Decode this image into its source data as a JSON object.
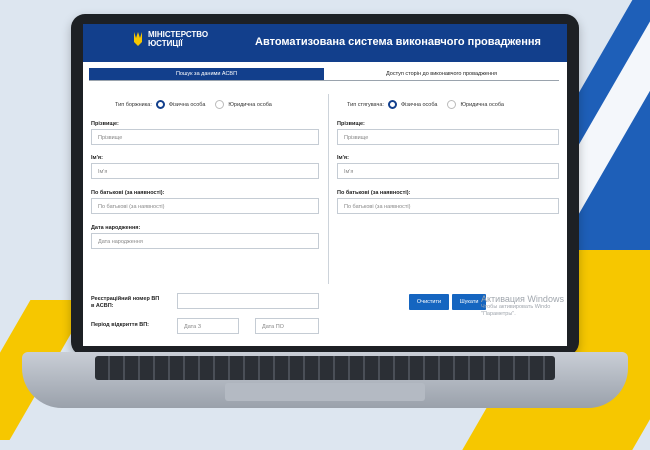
{
  "header": {
    "logo_line1": "МІНІСТЕРСТВО",
    "logo_line2": "ЮСТИЦІЇ",
    "title": "Автоматизована система виконавчого провадження"
  },
  "tabs": [
    {
      "label": "Пошук за даними АСВП"
    },
    {
      "label": "Доступ сторін до виконавчого провадження"
    }
  ],
  "left": {
    "type_label": "Тип боржника:",
    "option1": "Фізична особа",
    "option2": "Юридична особа",
    "surname_label": "Прізвище:",
    "surname_placeholder": "Прізвище",
    "name_label": "Ім'я:",
    "name_placeholder": "Ім'я",
    "patronymic_label": "По батькові (за наявності):",
    "patronymic_placeholder": "По батькові (за наявності)",
    "birth_label": "Дата народження:",
    "birth_placeholder": "Дата народження"
  },
  "right": {
    "type_label": "Тип стягувача:",
    "option1": "Фізична особа",
    "option2": "Юридична особа",
    "surname_label": "Прізвище:",
    "surname_placeholder": "Прізвище",
    "name_label": "Ім'я:",
    "name_placeholder": "Ім'я",
    "patronymic_label": "По батькові (за наявності):",
    "patronymic_placeholder": "По батькові (за наявності)"
  },
  "bottom": {
    "reg_label_1": "Реєстраційний номер ВП",
    "reg_label_2": "в АСВП:",
    "period_label": "Період відкриття ВП:",
    "date_from_placeholder": "Дата З",
    "date_to_placeholder": "Дата ПО",
    "clear_button": "Очистити",
    "search_button": "Шукати"
  },
  "watermark": {
    "title": "Активация Windows",
    "line1": "Чтобы активировать Windo",
    "line2": "\"Параметры\"."
  },
  "colors": {
    "primary": "#123f8c",
    "button": "#1565c0"
  }
}
